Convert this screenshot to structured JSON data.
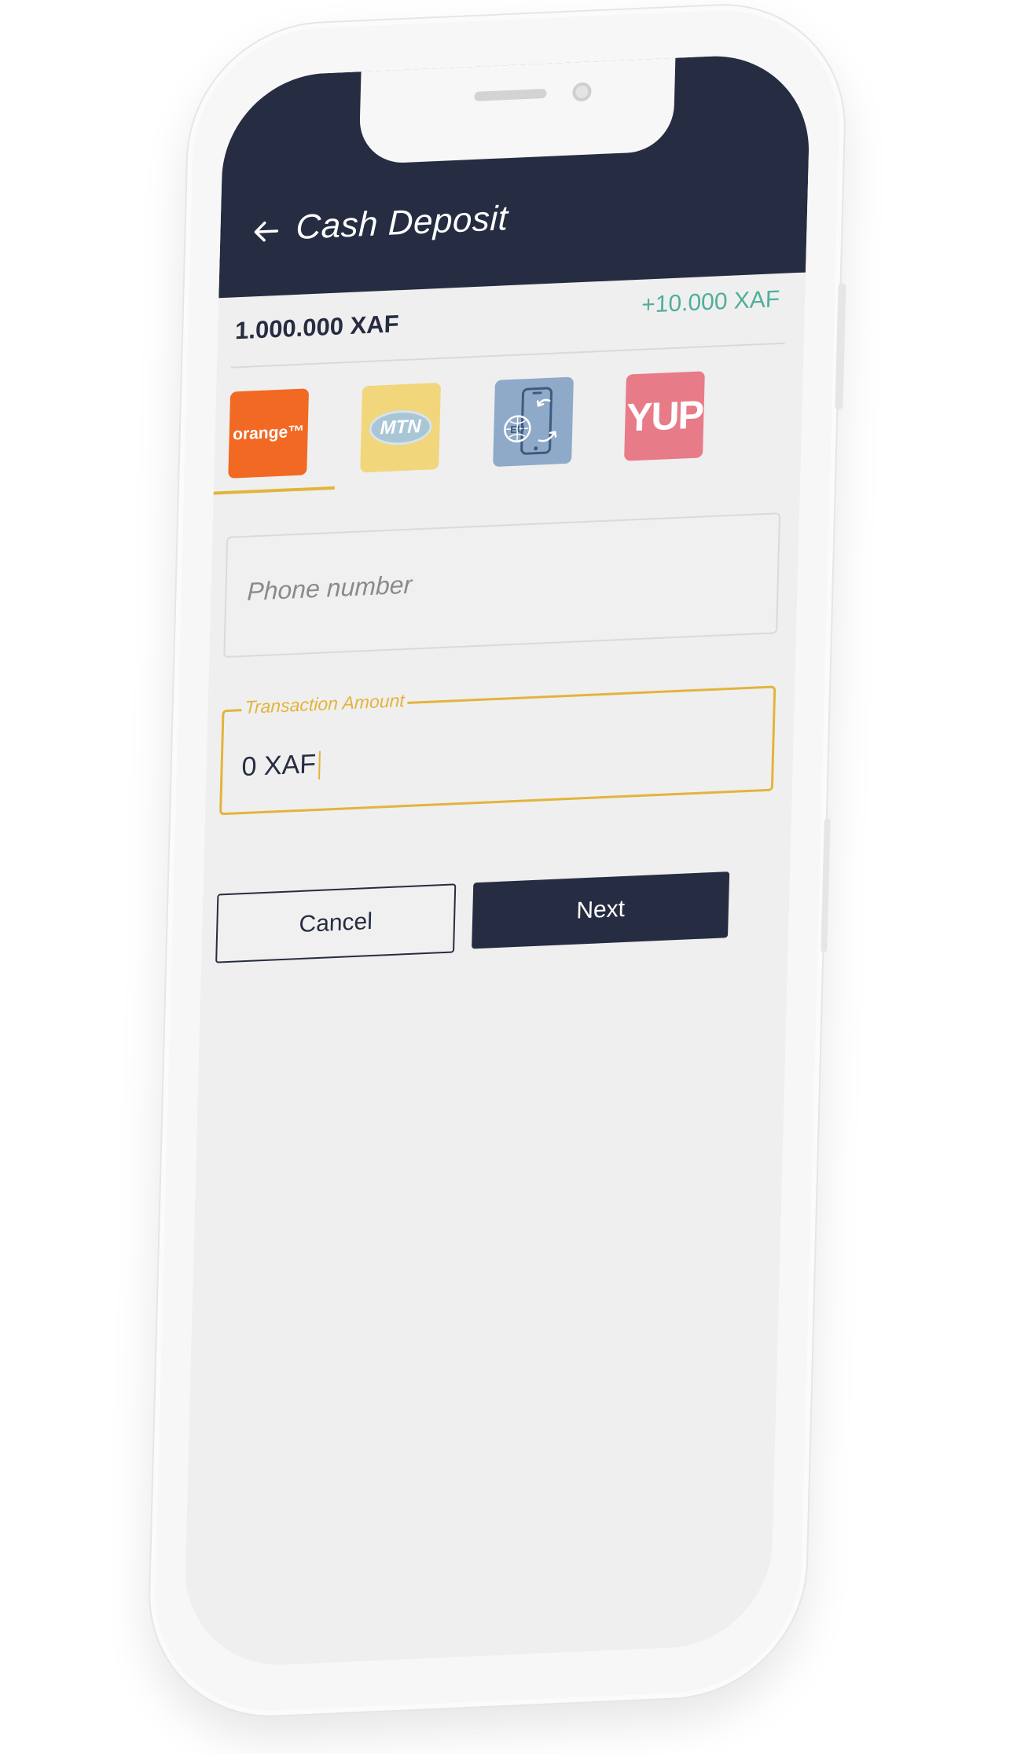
{
  "header": {
    "title": "Cash Deposit",
    "back_icon": "arrow-left-icon",
    "background_color": "#262c41"
  },
  "account": {
    "balance": "1.000.000 XAF",
    "bonus": "+10.000 XAF",
    "bonus_color": "#4fae9b"
  },
  "providers": [
    {
      "name": "orange",
      "label": "orange™",
      "color": "#f26924",
      "selected": true
    },
    {
      "name": "mtn",
      "label": "MTN",
      "color": "#f1d67c",
      "selected": false
    },
    {
      "name": "eu-mobile-money",
      "label": "EU",
      "color": "#8fa9c8",
      "selected": false
    },
    {
      "name": "yup",
      "label": "YUP",
      "color": "#e87b88",
      "selected": false
    }
  ],
  "form": {
    "phone_placeholder": "Phone number",
    "amount_label": "Transaction Amount",
    "amount_value": "0 XAF",
    "accent_color": "#e3b43c"
  },
  "buttons": {
    "cancel": "Cancel",
    "next": "Next"
  }
}
